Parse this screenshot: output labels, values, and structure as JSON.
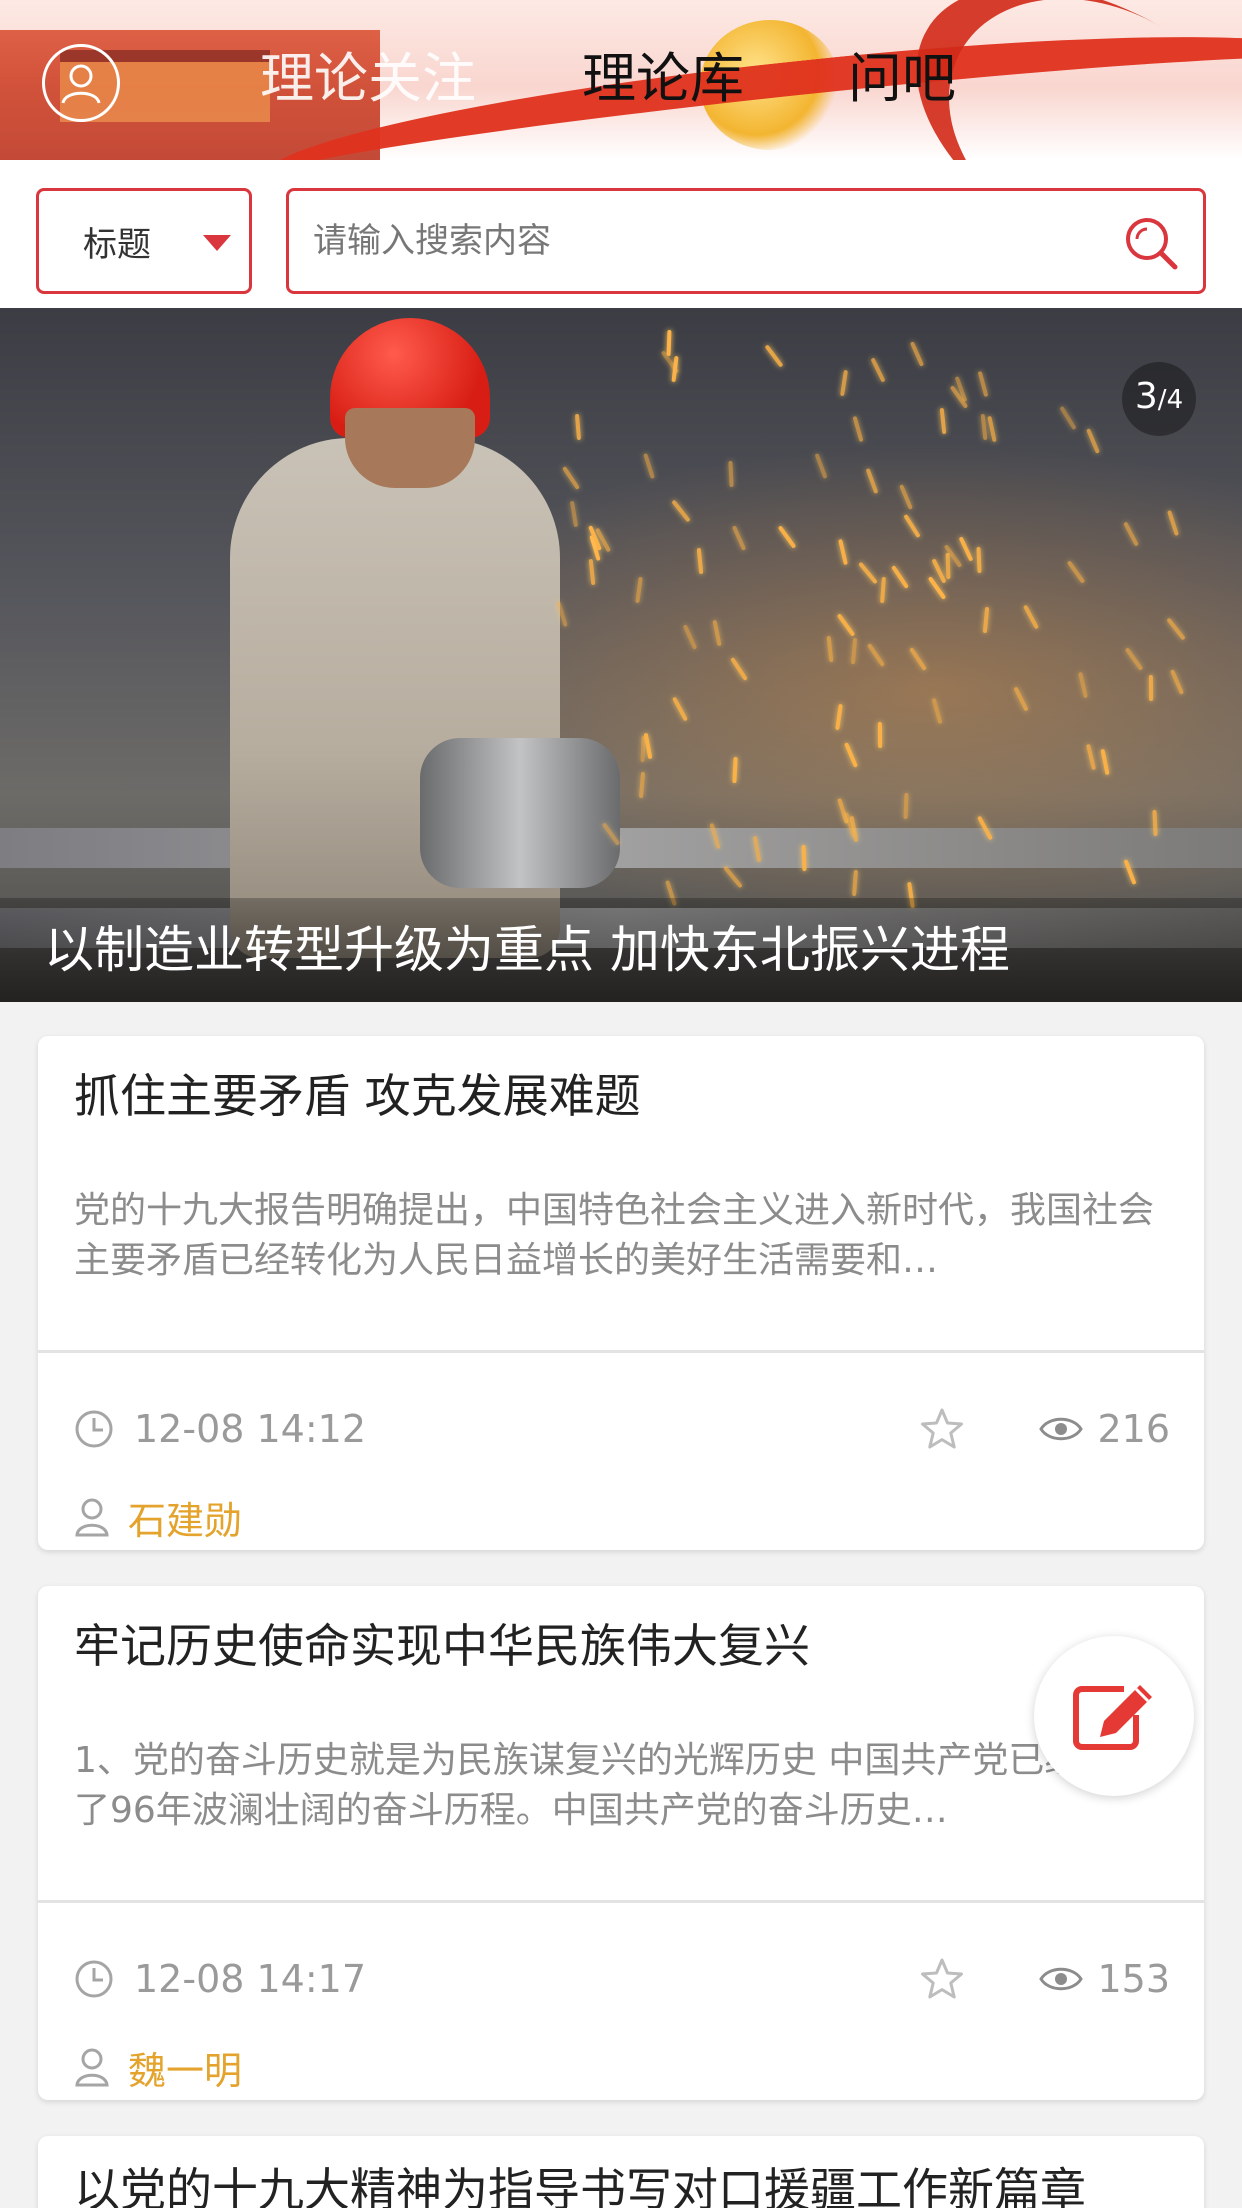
{
  "header": {
    "tabs": [
      {
        "label": "理论关注",
        "active": true
      },
      {
        "label": "理论库",
        "active": false
      },
      {
        "label": "问吧",
        "active": false
      }
    ]
  },
  "search": {
    "type_label": "标题",
    "placeholder": "请输入搜索内容"
  },
  "banner": {
    "page_current": "3",
    "page_total": "4",
    "caption": "以制造业转型升级为重点 加快东北振兴进程"
  },
  "articles": [
    {
      "title": "抓住主要矛盾 攻克发展难题",
      "summary": "党的十九大报告明确提出，中国特色社会主义进入新时代，我国社会主要矛盾已经转化为人民日益增长的美好生活需要和…",
      "time": "12-08 14:12",
      "views": "216",
      "author": "石建勋"
    },
    {
      "title": "牢记历史使命实现中华民族伟大复兴",
      "summary": "1、党的奋斗历史就是为民族谋复兴的光辉历史 中国共产党已经走过了96年波澜壮阔的奋斗历程。中国共产党的奋斗历史…",
      "time": "12-08 14:17",
      "views": "153",
      "author": "魏一明"
    },
    {
      "title": "以党的十九大精神为指导书写对口援疆工作新篇章"
    }
  ],
  "colors": {
    "accent_red": "#d9363e",
    "author_gold": "#e3a32c",
    "meta_gray": "#9a9a9a"
  },
  "icons": [
    "user-icon",
    "caret-down-icon",
    "search-icon",
    "clock-icon",
    "star-icon",
    "eye-icon",
    "person-icon",
    "edit-icon"
  ]
}
